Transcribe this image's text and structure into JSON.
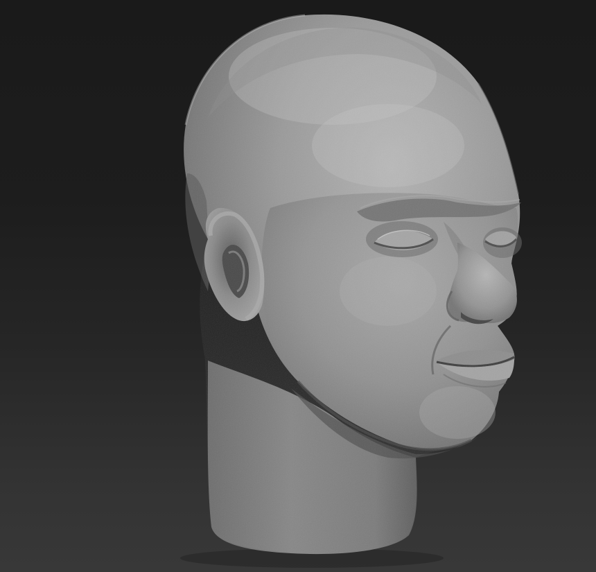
{
  "scene": {
    "subject": "sculpted-head",
    "background_top_color": "#1a1a1a",
    "background_bottom_color": "#383838",
    "clay_color": "#8f8f8f"
  }
}
